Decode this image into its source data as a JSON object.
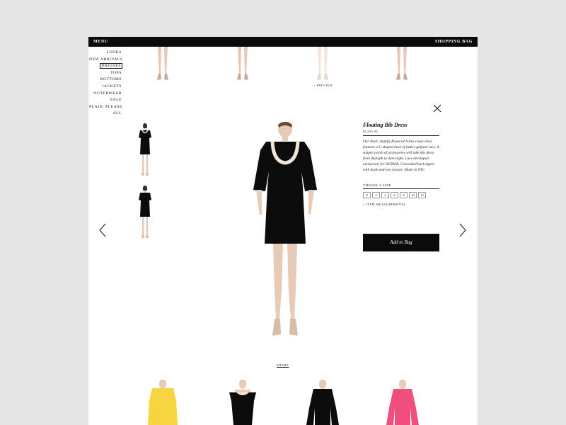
{
  "topbar": {
    "menu_label": "MENU",
    "bag_label": "SHOPPING BAG"
  },
  "sidenav": {
    "items": [
      {
        "label": "LOOKS"
      },
      {
        "label": "NEW ARRIVALS"
      },
      {
        "label": "DRESSES",
        "active": true
      },
      {
        "label": "TOPS"
      },
      {
        "label": "BOTTOMS"
      },
      {
        "label": "JACKETS"
      },
      {
        "label": "OUTERWEAR"
      },
      {
        "label": "SALE"
      },
      {
        "label": "PLAID, PLEASE."
      },
      {
        "label": "ALL"
      }
    ]
  },
  "preview": {
    "label": "+ PREVIEW"
  },
  "product": {
    "title": "Floating Bib Dress",
    "price": "$1,695.00",
    "description": "Our short, slightly flounced A-line crepe dress features a U-shaped inset of lattice guipure lace. A simple switch of accessories will take this dress from daylight to date-night. Lace developed exclusively for HONOR. Concealed back zipper with hook-and-eye closure. Made in NYC",
    "size_label": "CHOOSE A SIZE",
    "sizes": [
      "0",
      "2",
      "4",
      "6",
      "8",
      "10",
      "12"
    ],
    "measurements_link": "+ ITEM MEASUREMENTS",
    "add_to_bag": "Add to Bag"
  },
  "share": {
    "label": "SHARE"
  },
  "colors": {
    "dress_black": "#0c0c0c",
    "bib_cream": "#efe6d6",
    "skin": "#e8cbb7",
    "yellow": "#f6d540",
    "pink": "#ee4f7c"
  }
}
